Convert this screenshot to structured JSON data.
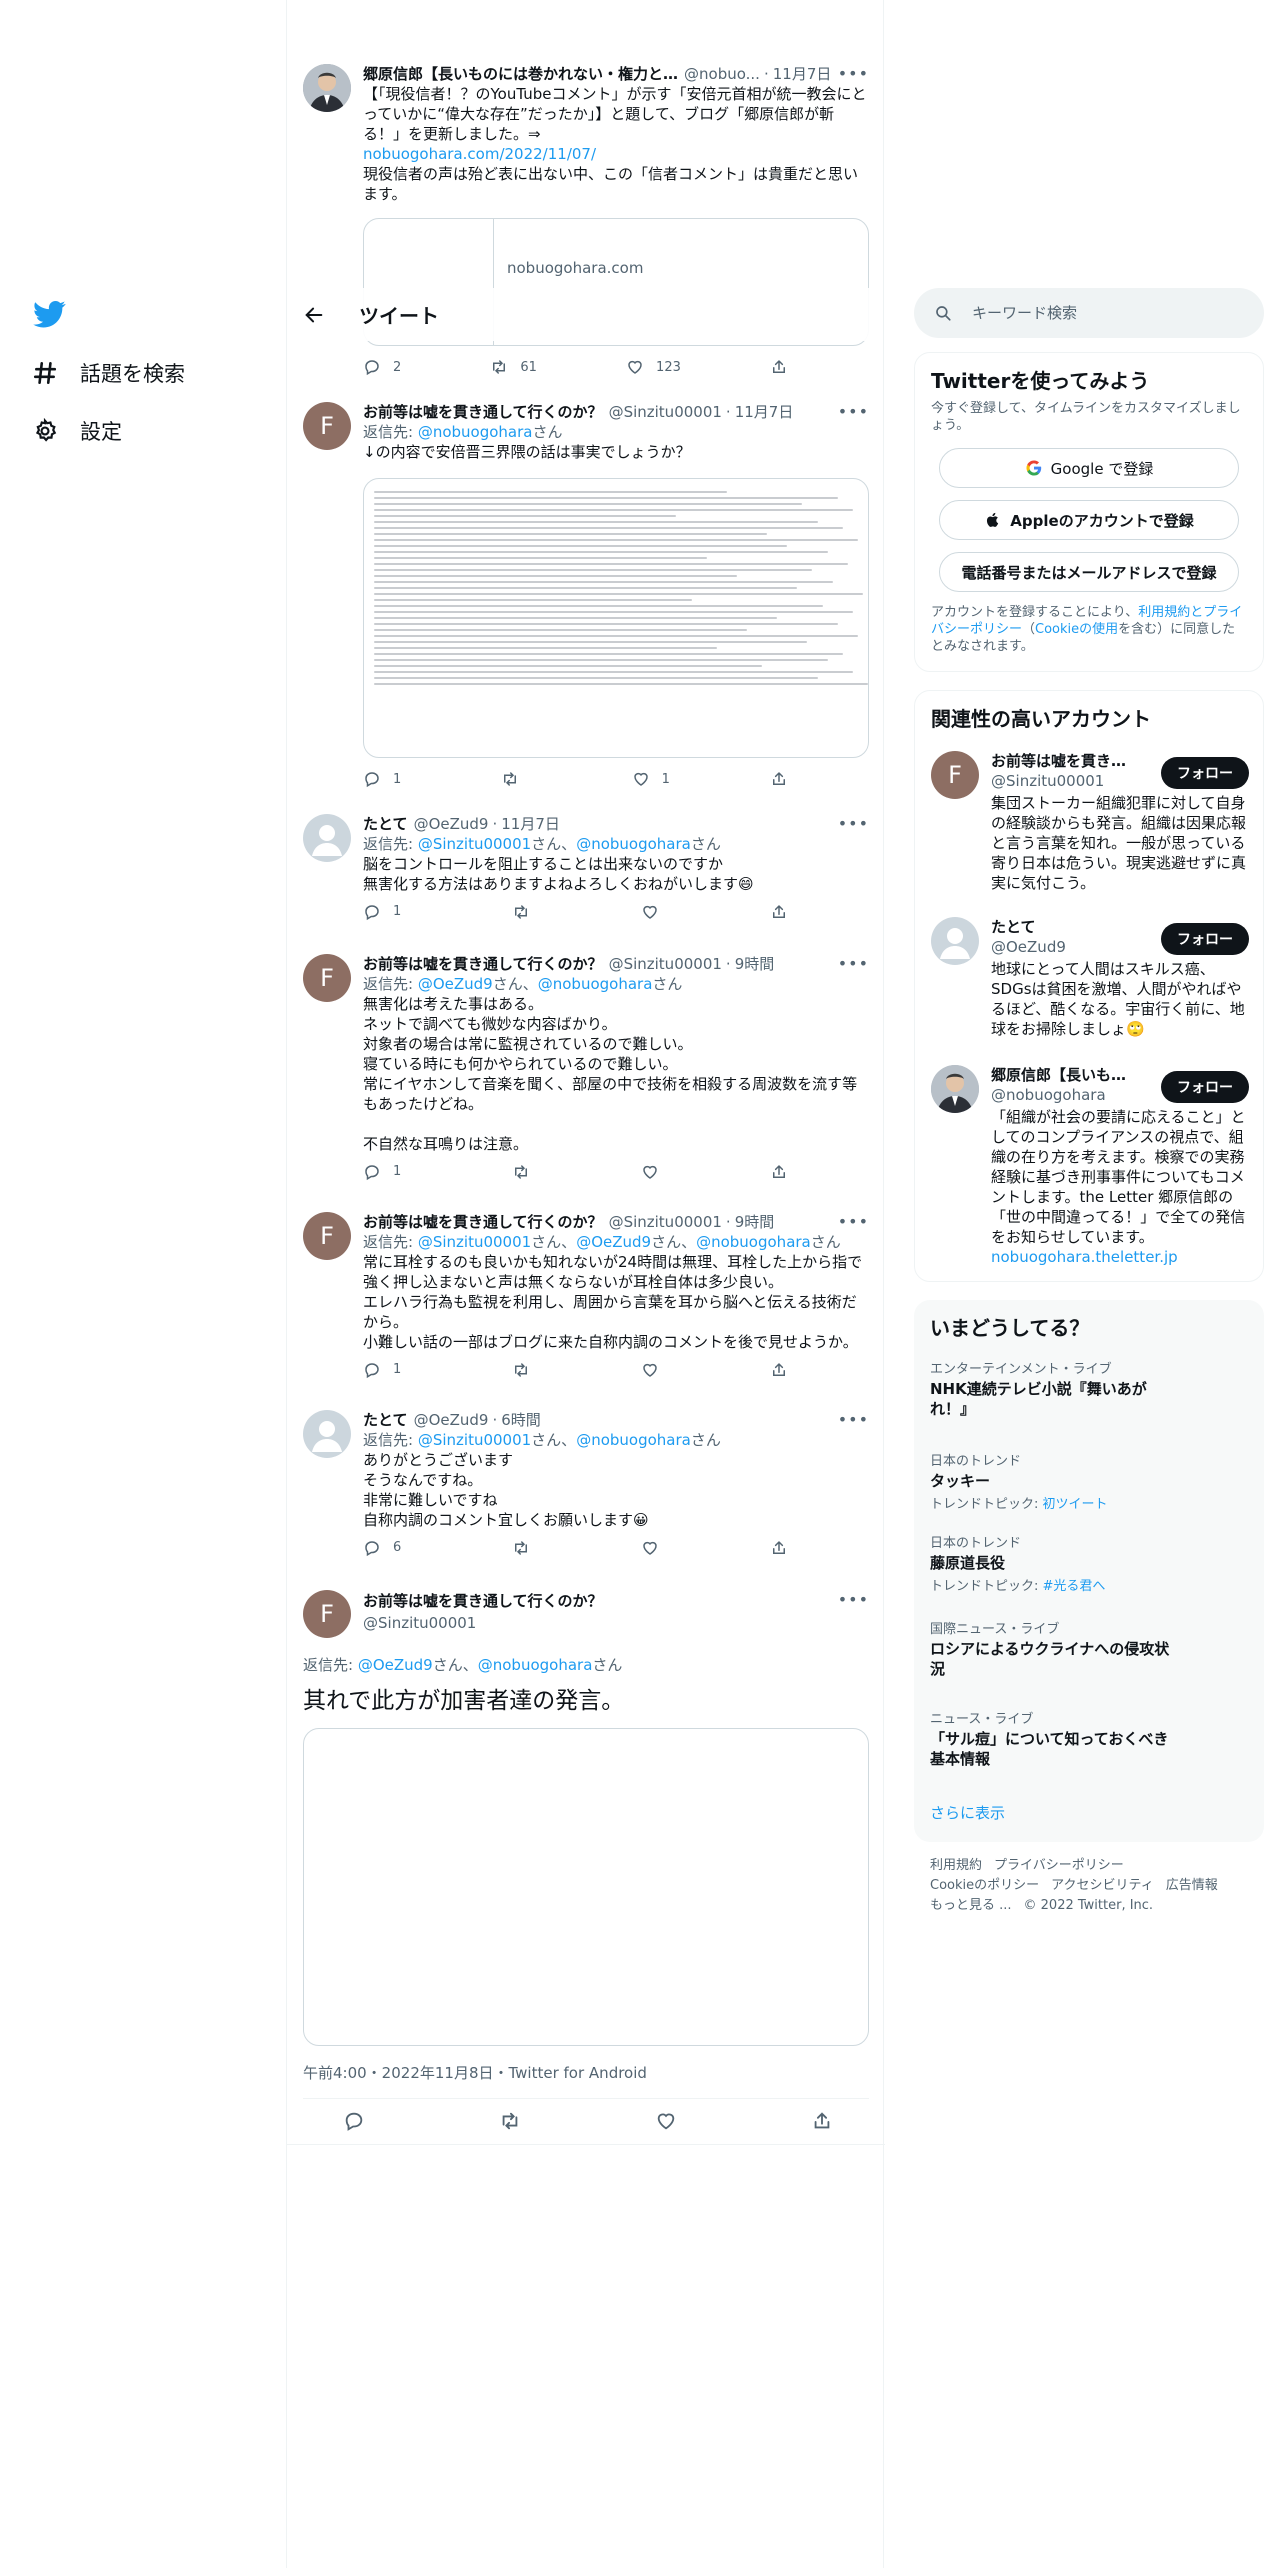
{
  "nav": {
    "explore_label": "話題を検索",
    "settings_label": "設定"
  },
  "header": {
    "title": "ツイート"
  },
  "tweets": [
    {
      "name": "郷原信郎【長いものには巻かれない・権力と…",
      "handle": "@nobuo...",
      "time": "11月7日",
      "text": "【「現役信者！？のYouTubeコメント」が示す「安倍元首相が統一教会にとっていかに“偉大な存在”だったか」】と題して、ブログ「郷原信郎が斬る！」を更新しました。⇒",
      "link": "nobuogohara.com/2022/11/07/",
      "text2": "現役信者の声は殆ど表に出ない中、この「信者コメント」は貴重だと思います。",
      "card_domain": "nobuogohara.com",
      "replies": "2",
      "retweets": "61",
      "likes": "123"
    },
    {
      "name": "お前等は嘘を貫き通して行くのか？",
      "handle": "@Sinzitu00001",
      "time": "11月7日",
      "reply_prefix": "返信先: ",
      "reply_users": "@nobuogohara",
      "reply_suffix": "さん",
      "text": "↓の内容で安倍晋三界隈の話は事実でしょうか？",
      "replies": "1",
      "retweets": "",
      "likes": "1"
    },
    {
      "name": "たとて",
      "handle": "@OeZud9",
      "time": "11月7日",
      "reply_prefix": "返信先: ",
      "reply_user1": "@Sinzitu00001",
      "reply_mid": "さん、",
      "reply_user2": "@nobuogohara",
      "reply_suffix": "さん",
      "text": "脳をコントロールを阻止することは出来ないのですか\n無害化する方法はありますよねよろしくおねがいします😄",
      "replies": "1",
      "retweets": "",
      "likes": ""
    },
    {
      "name": "お前等は嘘を貫き通して行くのか？",
      "handle": "@Sinzitu00001",
      "time": "9時間",
      "reply_prefix": "返信先: ",
      "reply_user1": "@OeZud9",
      "reply_mid": "さん、",
      "reply_user2": "@nobuogohara",
      "reply_suffix": "さん",
      "text": "無害化は考えた事はある。\nネットで調べても微妙な内容ばかり。\n対象者の場合は常に監視されているので難しい。\n寝ている時にも何かやられているので難しい。\n常にイヤホンして音楽を聞く、部屋の中で技術を相殺する周波数を流す等もあったけどね。\n\n不自然な耳鳴りは注意。",
      "replies": "1",
      "retweets": "",
      "likes": ""
    },
    {
      "name": "お前等は嘘を貫き通して行くのか？",
      "handle": "@Sinzitu00001",
      "time": "9時間",
      "reply_prefix": "返信先: ",
      "reply_user1": "@Sinzitu00001",
      "reply_mid": "さん、",
      "reply_user2": "@OeZud9",
      "reply_mid2": "さん、",
      "reply_user3": "@nobuogohara",
      "reply_suffix": "さん",
      "text": "常に耳栓するのも良いかも知れないが24時間は無理、耳栓した上から指で強く押し込まないと声は無くならないが耳栓自体は多少良い。\nエレハラ行為も監視を利用し、周囲から言葉を耳から脳へと伝える技術だから。\n小難しい話の一部はブログに来た自称内調のコメントを後で見せようか。",
      "replies": "1",
      "retweets": "",
      "likes": ""
    },
    {
      "name": "たとて",
      "handle": "@OeZud9",
      "time": "6時間",
      "reply_prefix": "返信先: ",
      "reply_user1": "@Sinzitu00001",
      "reply_mid": "さん、",
      "reply_user2": "@nobuogohara",
      "reply_suffix": "さん",
      "text": "ありがとうございます\nそうなんですね。\n非常に難しいですね\n自称内調のコメント宜しくお願いします😀",
      "replies": "6",
      "retweets": "",
      "likes": ""
    }
  ],
  "focus": {
    "name": "お前等は嘘を貫き通して行くのか？",
    "handle": "@Sinzitu00001",
    "reply_prefix": "返信先: ",
    "reply_user1": "@OeZud9",
    "reply_mid": "さん、",
    "reply_user2": "@nobuogohara",
    "reply_suffix": "さん",
    "text": "其れで此方が加害者達の発言。",
    "meta": "午前4:00・2022年11月8日・Twitter for Android"
  },
  "sidebar": {
    "search_placeholder": "キーワード検索",
    "signup": {
      "title": "Twitterを使ってみよう",
      "desc": "今すぐ登録して、タイムラインをカスタマイズしましょう。",
      "google_label": "Google で登録",
      "apple_label": "Appleのアカウントで登録",
      "phone_label": "電話番号またはメールアドレスで登録",
      "terms_prefix": "アカウントを登録することにより、",
      "terms_link": "利用規約とプライバシーポリシー",
      "terms_mid": "（",
      "cookie_link": "Cookieの使用",
      "terms_suffix": "を含む）に同意したとみなされます。"
    },
    "related": {
      "title": "関連性の高いアカウント",
      "follow_label": "フォロー",
      "accounts": [
        {
          "name": "お前等は嘘を貫き通...",
          "handle": "@Sinzitu00001",
          "bio": "集団ストーカー組織犯罪に対して自身の経験談からも発言。組織は因果応報と言う言葉を知れ。一般が思っている寄り日本は危うい。現実逃避せずに真実に気付こう。"
        },
        {
          "name": "たとて",
          "handle": "@OeZud9",
          "bio": "地球にとって人間はスキルス癌、SDGsは貧困を激増、人間がやればやるほど、酷くなる。宇宙行く前に、地球をお掃除しましょ🙄"
        },
        {
          "name": "郷原信郎【長いもの...",
          "handle": "@nobuogohara",
          "bio": "「組織が社会の要請に応えること」としてのコンプライアンスの視点で、組織の在り方を考えます。検察での実務経験に基づき刑事事件についてもコメントします。the Letter 郷原信郎の「世の中間違ってる！」で全ての発信をお知らせしています。",
          "bio_link": "nobuogohara.theletter.jp"
        }
      ]
    },
    "trends": {
      "title": "いまどうしてる？",
      "items": [
        {
          "category": "エンターテインメント・ライブ",
          "title": "NHK連続テレビ小説『舞いあがれ！』",
          "sub_prefix": "",
          "sub_link": ""
        },
        {
          "category": "日本のトレンド",
          "title": "タッキー",
          "sub_prefix": "トレンドトピック: ",
          "sub_link": "初ツイート"
        },
        {
          "category": "日本のトレンド",
          "title": "藤原道長役",
          "sub_prefix": "トレンドトピック: ",
          "sub_link": "#光る君へ"
        },
        {
          "category": "国際ニュース・ライブ",
          "title": "ロシアによるウクライナへの侵攻状況",
          "sub_prefix": "",
          "sub_link": ""
        },
        {
          "category": "ニュース・ライブ",
          "title": "「サル痘」について知っておくべき基本情報",
          "sub_prefix": "",
          "sub_link": ""
        }
      ],
      "show_more": "さらに表示"
    },
    "footer": {
      "links1": [
        "利用規約",
        "プライバシーポリシー"
      ],
      "links2": [
        "Cookieのポリシー",
        "アクセシビリティ",
        "広告情報"
      ],
      "more": "もっと見る ...",
      "copyright": "© 2022 Twitter, Inc."
    }
  }
}
